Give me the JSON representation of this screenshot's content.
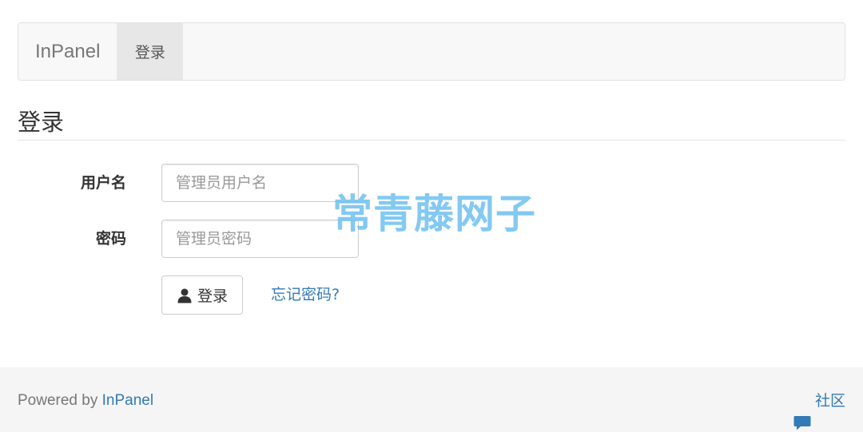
{
  "navbar": {
    "brand": "InPanel",
    "active_tab": "登录"
  },
  "page": {
    "heading": "登录"
  },
  "form": {
    "username_label": "用户名",
    "username_placeholder": "管理员用户名",
    "username_value": "",
    "password_label": "密码",
    "password_placeholder": "管理员密码",
    "password_value": "",
    "login_button": "登录",
    "login_icon": "user-icon",
    "forgot_link": "忘记密码?"
  },
  "watermark": {
    "text": "常青藤网子"
  },
  "footer": {
    "powered_prefix": "Powered by ",
    "powered_link": "InPanel",
    "community_icon": "comment-icon",
    "community_link": "社区"
  },
  "colors": {
    "link": "#337ab7",
    "navbar_bg": "#f8f8f8",
    "active_tab_bg": "#e7e7e7",
    "footer_bg": "#f5f5f5",
    "watermark": "#6ec0f0"
  }
}
